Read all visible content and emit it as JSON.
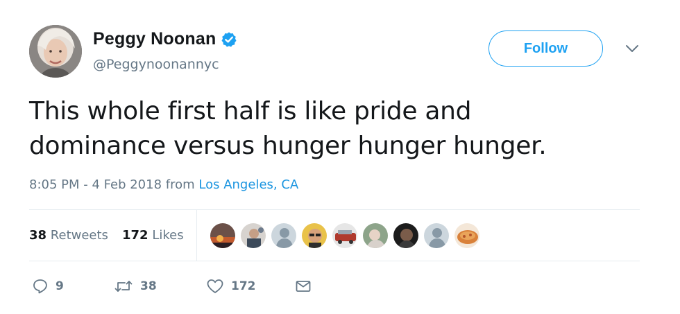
{
  "author": {
    "display_name": "Peggy Noonan",
    "handle": "@Peggynoonannyc",
    "avatar_icon": "user-avatar",
    "verified_icon": "verified-badge-icon"
  },
  "follow_button": {
    "label": "Follow"
  },
  "menu": {
    "icon": "chevron-down-icon"
  },
  "tweet": {
    "text_lines": [
      "This whole first half is like pride and",
      "dominance versus hunger hunger hunger."
    ]
  },
  "meta": {
    "time": "8:05 PM - 4 Feb 2018 from",
    "location": "Los Angeles, CA"
  },
  "stats": {
    "retweets_count": "38",
    "retweets_label": "Retweets",
    "likes_count": "172",
    "likes_label": "Likes"
  },
  "likers": [
    "liker-avatar-1",
    "liker-avatar-2",
    "liker-avatar-3",
    "liker-avatar-4",
    "liker-avatar-5",
    "liker-avatar-6",
    "liker-avatar-7",
    "liker-avatar-8",
    "liker-avatar-9"
  ],
  "actions": {
    "reply_count": "9",
    "retweet_count": "38",
    "like_count": "172"
  },
  "colors": {
    "accent": "#1da1f2",
    "link": "#1b95e0",
    "muted": "#657786",
    "text": "#14171a",
    "border": "#e6ecf0"
  }
}
